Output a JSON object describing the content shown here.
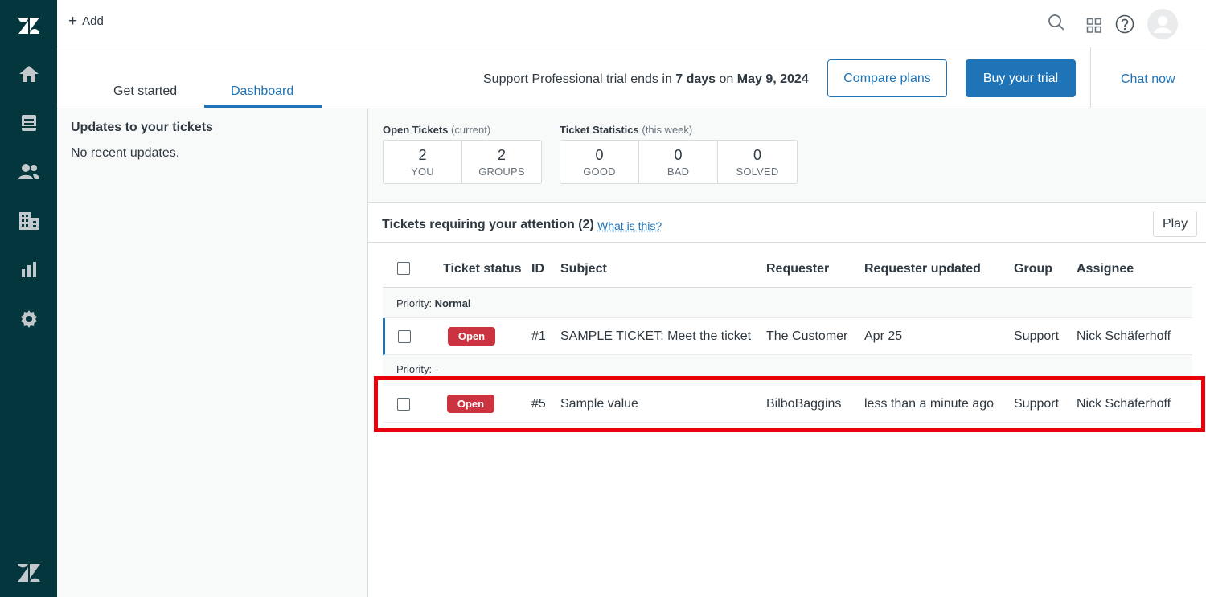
{
  "topbar": {
    "add_label": "Add"
  },
  "header": {
    "tabs": [
      {
        "label": "Get started"
      },
      {
        "label": "Dashboard"
      }
    ],
    "trial_prefix": "Support Professional trial ends in ",
    "trial_days": "7 days",
    "trial_on": " on ",
    "trial_date": "May 9, 2024",
    "compare_label": "Compare plans",
    "buy_label": "Buy your trial",
    "chat_label": "Chat now"
  },
  "updates": {
    "title": "Updates to your tickets",
    "empty": "No recent updates."
  },
  "open_tickets": {
    "title": "Open Tickets",
    "sub": "(current)",
    "cells": [
      {
        "value": "2",
        "label": "YOU"
      },
      {
        "value": "2",
        "label": "GROUPS"
      }
    ]
  },
  "ticket_stats": {
    "title": "Ticket Statistics",
    "sub": "(this week)",
    "cells": [
      {
        "value": "0",
        "label": "GOOD"
      },
      {
        "value": "0",
        "label": "BAD"
      },
      {
        "value": "0",
        "label": "SOLVED"
      }
    ]
  },
  "attention": {
    "title": "Tickets requiring your attention (2)",
    "what_is": "What is this?",
    "play_label": "Play"
  },
  "table": {
    "headers": [
      "Ticket status",
      "ID",
      "Subject",
      "Requester",
      "Requester updated",
      "Group",
      "Assignee"
    ],
    "groups": [
      {
        "priority_label": "Priority: ",
        "priority_value": "Normal",
        "rows": [
          {
            "status": "Open",
            "id": "#1",
            "subject": "SAMPLE TICKET: Meet the ticket",
            "requester": "The Customer",
            "updated": "Apr 25",
            "group": "Support",
            "assignee": "Nick Schäferhoff"
          }
        ]
      },
      {
        "priority_label": "Priority: -",
        "rows": [
          {
            "status": "Open",
            "id": "#5",
            "subject": "Sample value",
            "requester": "BilboBaggins",
            "updated": "less than a minute ago",
            "group": "Support",
            "assignee": "Nick Schäferhoff"
          }
        ]
      }
    ]
  },
  "colors": {
    "nav_bg": "#03363d",
    "accent": "#1f73b7",
    "open_badge": "#cc3340",
    "highlight": "#e8000b"
  }
}
